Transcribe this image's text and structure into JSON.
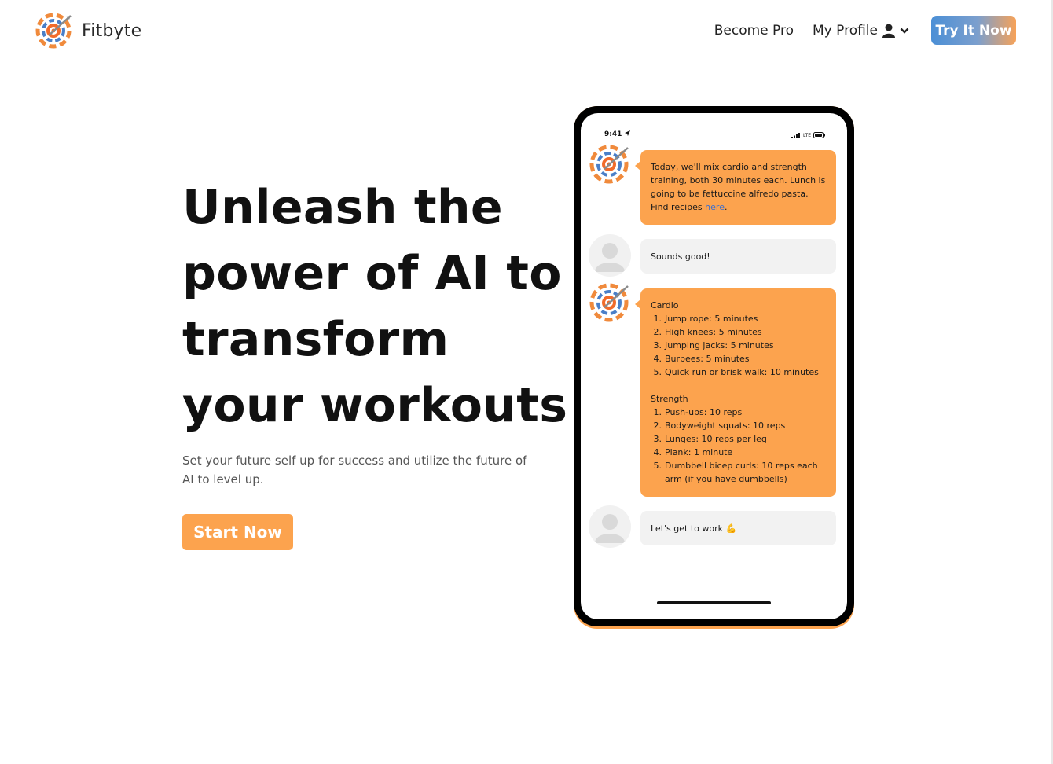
{
  "header": {
    "brand": "Fitbyte",
    "nav": {
      "become_pro": "Become Pro",
      "my_profile": "My Profile",
      "try_it_now": "Try It Now"
    }
  },
  "hero": {
    "title_lines": [
      "Unleash the",
      "power of AI to",
      "transform",
      "your workouts"
    ],
    "subtitle": "Set your future self up for success and utilize the future of AI to level up.",
    "cta": "Start Now"
  },
  "phone": {
    "status": {
      "time": "9:41",
      "network": "LTE"
    },
    "chat": {
      "msg1": {
        "text": "Today, we'll mix cardio and strength training, both 30 minutes each. Lunch is going to be fettuccine alfredo pasta. Find recipes",
        "link": "here",
        "end": "."
      },
      "msg2": "Sounds good!",
      "msg3": {
        "cardio_heading": "Cardio",
        "cardio": [
          "Jump rope: 5 minutes",
          "High knees: 5 minutes",
          "Jumping jacks: 5 minutes",
          "Burpees: 5 minutes",
          "Quick run or brisk walk: 10 minutes"
        ],
        "strength_heading": "Strength",
        "strength": [
          "Push-ups: 10 reps",
          "Bodyweight squats: 10 reps",
          "Lunges: 10 reps per leg",
          "Plank: 1 minute",
          "Dumbbell bicep curls: 10 reps each arm (if you have dumbbells)"
        ]
      },
      "msg4": "Let's get to work 💪"
    }
  },
  "colors": {
    "accent_orange": "#fca34e",
    "accent_blue": "#4b8fd6"
  },
  "icons": {
    "logo": "fitbyte-target-logo-icon",
    "profile": "user-icon",
    "dropdown": "chevron-down-icon",
    "location": "location-arrow-icon",
    "signal": "signal-bars-icon",
    "battery": "battery-icon"
  }
}
